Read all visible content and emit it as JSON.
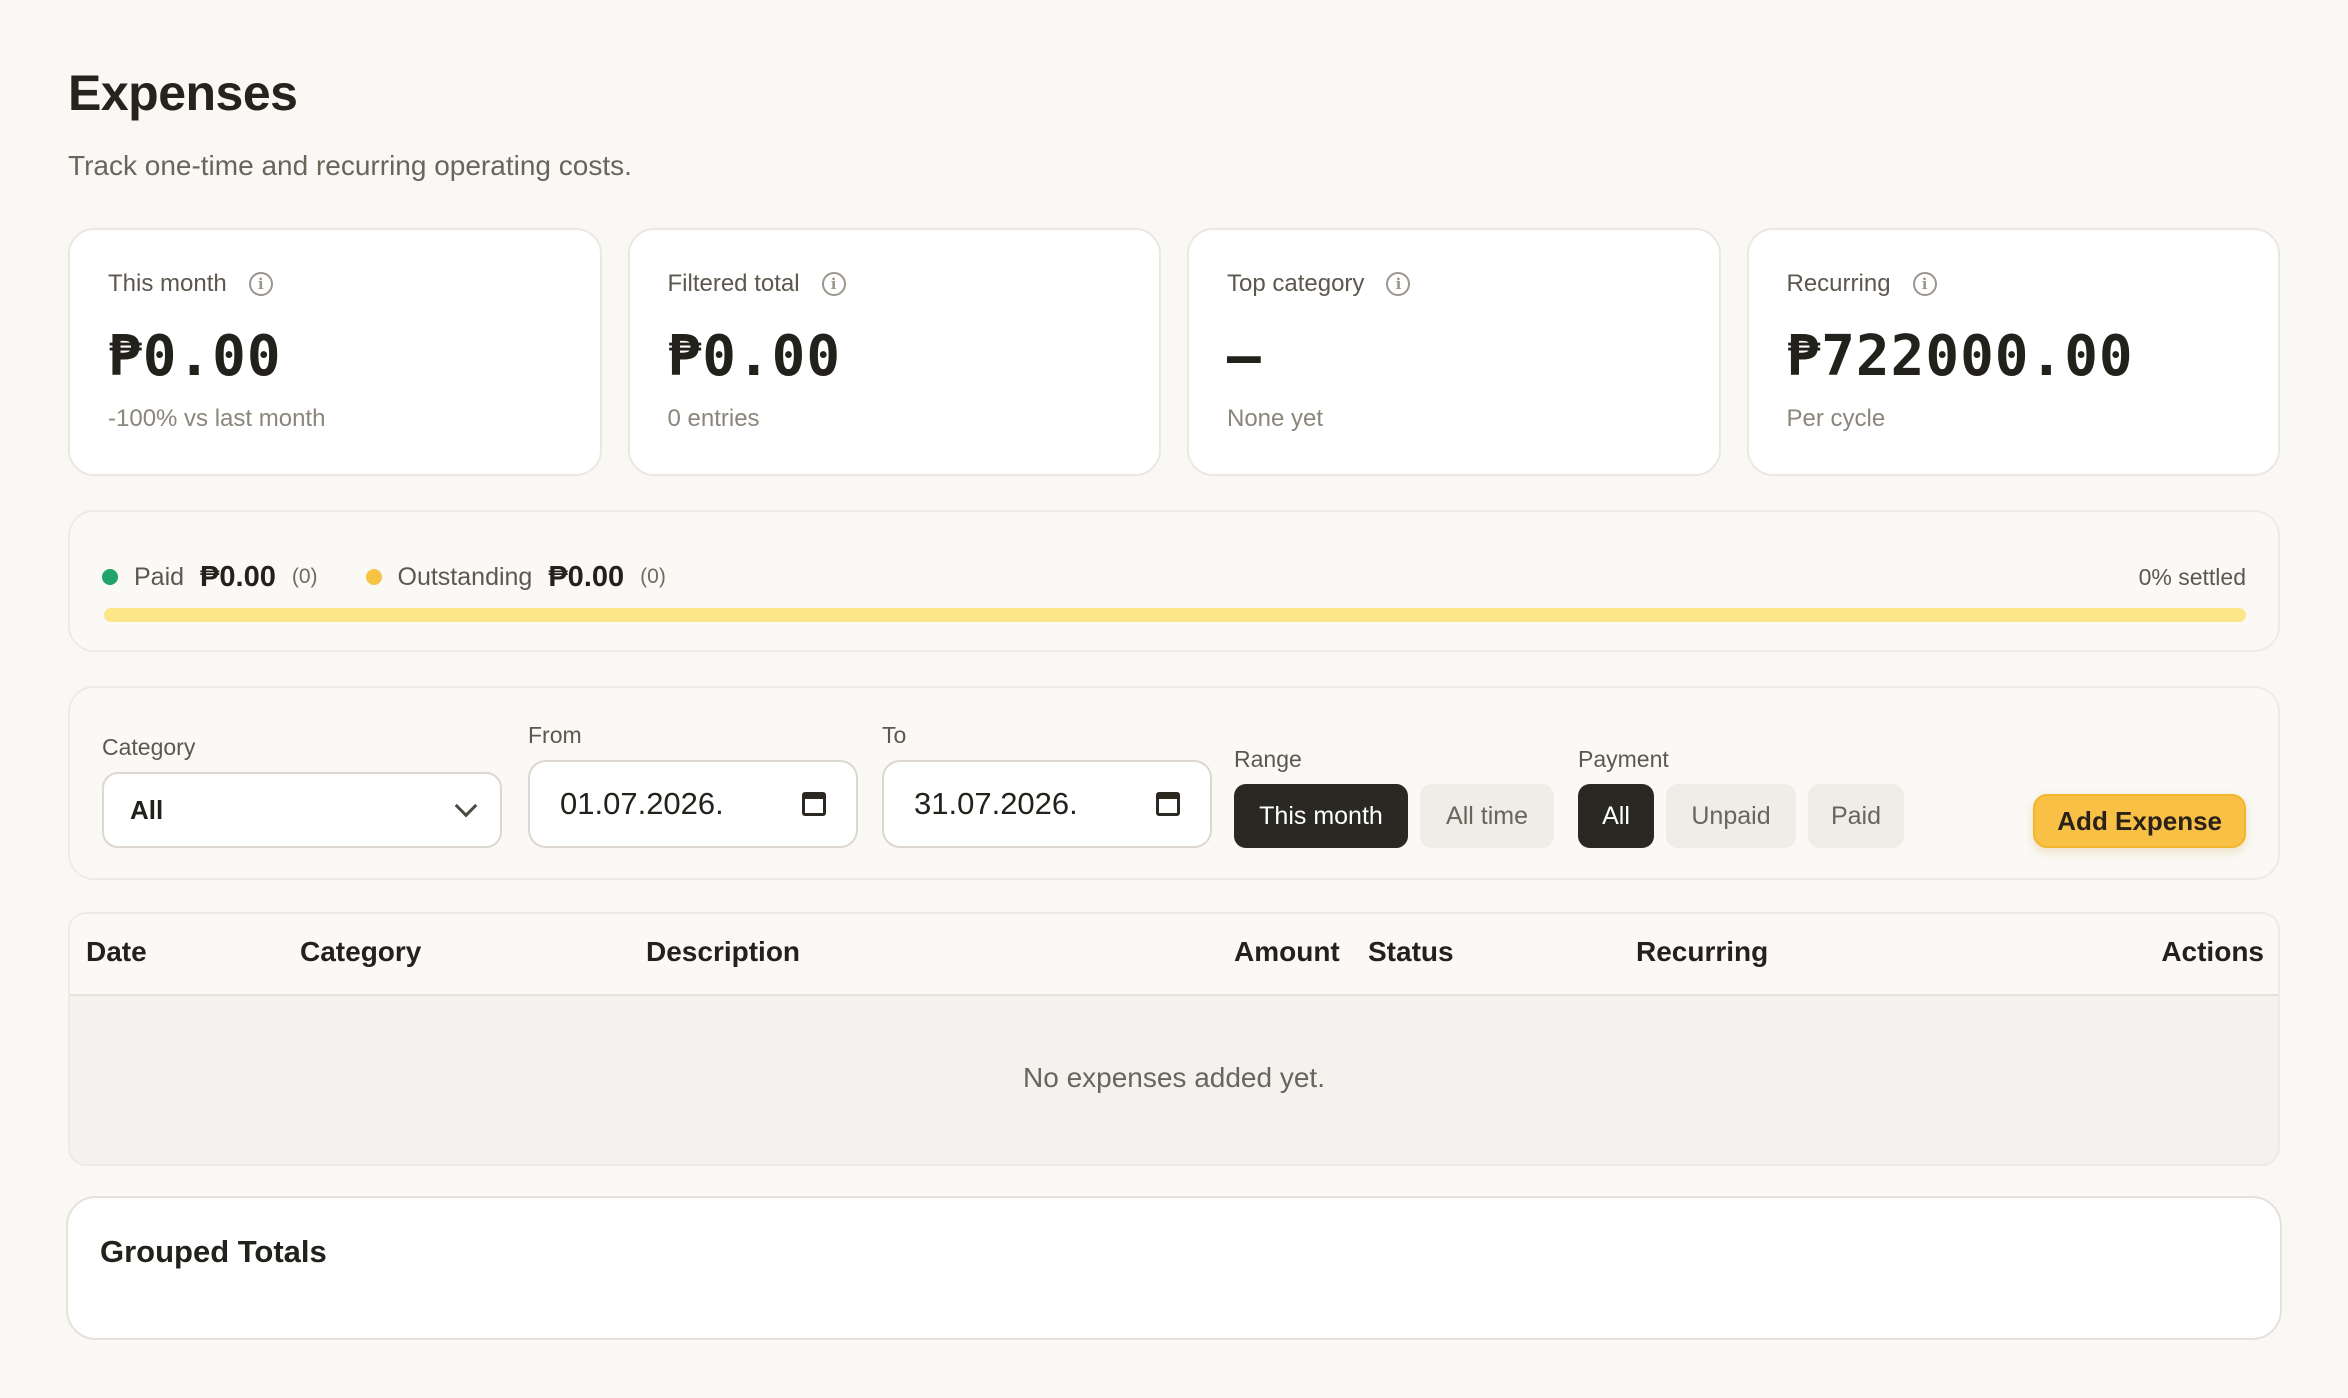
{
  "header": {
    "title": "Expenses",
    "subtitle": "Track one-time and recurring operating costs."
  },
  "stats": [
    {
      "label": "This month",
      "value": "₱0.00",
      "sub": "-100% vs last month"
    },
    {
      "label": "Filtered total",
      "value": "₱0.00",
      "sub": "0 entries"
    },
    {
      "label": "Top category",
      "value": "—",
      "sub": "None yet"
    },
    {
      "label": "Recurring",
      "value": "₱722000.00",
      "sub": "Per cycle"
    }
  ],
  "settlement": {
    "paid_label": "Paid",
    "paid_amount": "₱0.00",
    "paid_count": "(0)",
    "outstanding_label": "Outstanding",
    "outstanding_amount": "₱0.00",
    "outstanding_count": "(0)",
    "settled_text": "0% settled",
    "settled_fraction": 0,
    "paid_color": "#21a36b",
    "outstanding_color": "#f6c343"
  },
  "filters": {
    "category_label": "Category",
    "category_value": "All",
    "from_label": "From",
    "from_value": "01.07.2026.",
    "to_label": "To",
    "to_value": "31.07.2026.",
    "range_label": "Range",
    "range_options": [
      "This month",
      "All time"
    ],
    "range_selected": "This month",
    "payment_label": "Payment",
    "payment_options": [
      "All",
      "Unpaid",
      "Paid"
    ],
    "payment_selected": "All",
    "add_button": "Add Expense"
  },
  "table": {
    "columns": [
      "Date",
      "Category",
      "Description",
      "Amount",
      "Status",
      "Recurring",
      "Actions"
    ],
    "empty_message": "No expenses added yet."
  },
  "grouped": {
    "title": "Grouped Totals"
  },
  "colors": {
    "accent": "#f8c146",
    "dark": "#2a2822",
    "background": "#f9f8f5"
  }
}
